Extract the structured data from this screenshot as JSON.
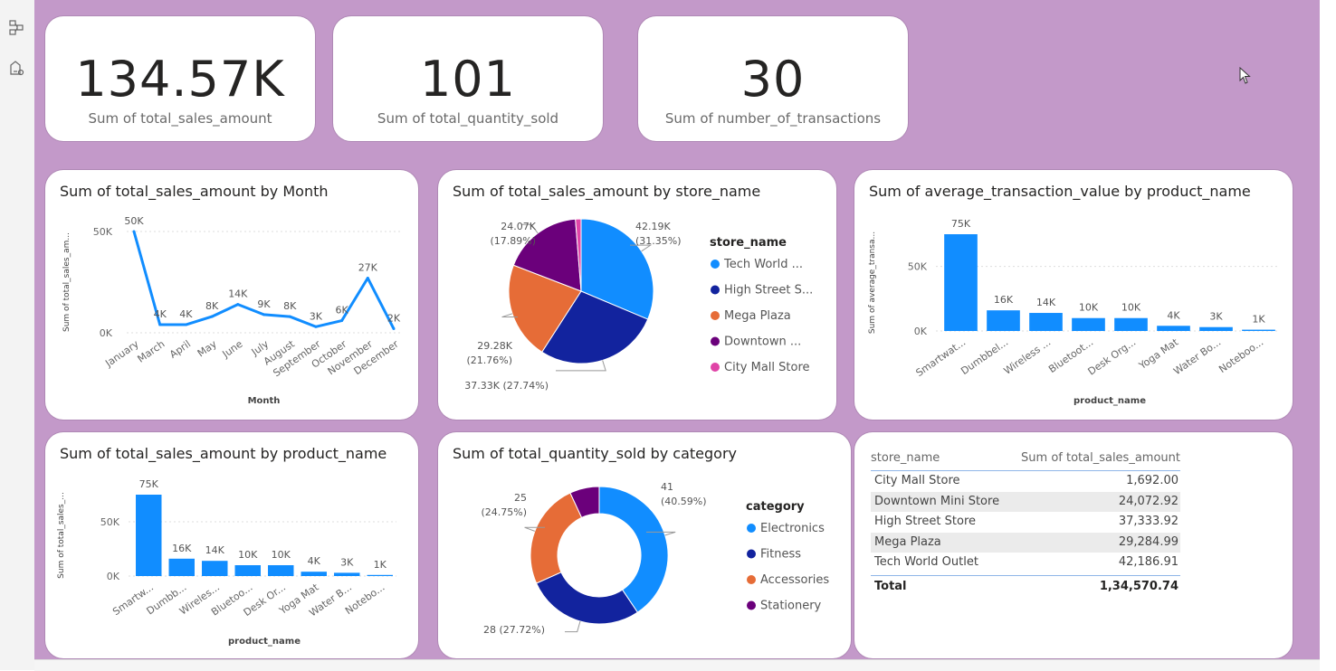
{
  "kpis": [
    {
      "value": "134.57K",
      "label": "Sum of total_sales_amount"
    },
    {
      "value": "101",
      "label": "Sum of total_quantity_sold"
    },
    {
      "value": "30",
      "label": "Sum of number_of_transactions"
    }
  ],
  "colors": {
    "canvas": "#c399c9",
    "blue": "#118dff",
    "navy": "#12239e",
    "orange": "#e66c37",
    "purple": "#6b007b",
    "magenta": "#e044a7"
  },
  "left_rail": {
    "icons": [
      "table-model-icon",
      "report-view-icon"
    ]
  },
  "chart_data": [
    {
      "type": "line",
      "title": "Sum of total_sales_amount by Month",
      "x": [
        "January",
        "March",
        "April",
        "May",
        "June",
        "July",
        "August",
        "September",
        "October",
        "November",
        "December"
      ],
      "values": [
        50,
        4,
        4,
        8,
        14,
        9,
        8,
        3,
        6,
        27,
        2
      ],
      "data_labels": [
        "50K",
        "4K",
        "4K",
        "8K",
        "14K",
        "9K",
        "8K",
        "3K",
        "6K",
        "27K",
        "2K"
      ],
      "yticks": [
        "0K",
        "50K"
      ],
      "ylim": [
        0,
        50
      ],
      "xlabel": "Month",
      "ylabel": "Sum of total_sales_am...",
      "grid": true
    },
    {
      "type": "pie",
      "title": "Sum of total_sales_amount by store_name",
      "legend_title": "store_name",
      "legend_position": "right",
      "slices": [
        {
          "name": "Tech World ...",
          "value": 42.19,
          "label": "42.19K",
          "pct": "(31.35%)",
          "color": "#118dff"
        },
        {
          "name": "High Street S...",
          "value": 37.33,
          "label": "37.33K (27.74%)",
          "pct": "",
          "color": "#12239e"
        },
        {
          "name": "Mega Plaza",
          "value": 29.28,
          "label": "29.28K",
          "pct": "(21.76%)",
          "color": "#e66c37"
        },
        {
          "name": "Downtown ...",
          "value": 24.07,
          "label": "24.07K",
          "pct": "(17.89%)",
          "color": "#6b007b"
        },
        {
          "name": "City Mall Store",
          "value": 1.69,
          "label": "",
          "pct": "",
          "color": "#e044a7"
        }
      ]
    },
    {
      "type": "bar",
      "title": "Sum of average_transaction_value by product_name",
      "categories": [
        "Smartwat...",
        "Dumbbel...",
        "Wireless ...",
        "Bluetoot...",
        "Desk Org...",
        "Yoga Mat",
        "Water Bo...",
        "Noteboo..."
      ],
      "values": [
        75,
        16,
        14,
        10,
        10,
        4,
        3,
        1
      ],
      "data_labels": [
        "75K",
        "16K",
        "14K",
        "10K",
        "10K",
        "4K",
        "3K",
        "1K"
      ],
      "yticks": [
        "0K",
        "50K"
      ],
      "ylim": [
        0,
        75
      ],
      "xlabel": "product_name",
      "ylabel": "Sum of average_transa...",
      "grid": true
    },
    {
      "type": "bar",
      "title": "Sum of total_sales_amount by product_name",
      "categories": [
        "Smartw...",
        "Dumbb...",
        "Wireles...",
        "Bluetoo...",
        "Desk Or...",
        "Yoga Mat",
        "Water B...",
        "Notebo..."
      ],
      "values": [
        75,
        16,
        14,
        10,
        10,
        4,
        3,
        1
      ],
      "data_labels": [
        "75K",
        "16K",
        "14K",
        "10K",
        "10K",
        "4K",
        "3K",
        "1K"
      ],
      "yticks": [
        "0K",
        "50K"
      ],
      "ylim": [
        0,
        75
      ],
      "xlabel": "product_name",
      "ylabel": "Sum of total_sales_...",
      "grid": true
    },
    {
      "type": "pie",
      "donut": true,
      "title": "Sum of total_quantity_sold by category",
      "legend_title": "category",
      "legend_position": "right",
      "slices": [
        {
          "name": "Electronics",
          "value": 41,
          "label": "41",
          "pct": "(40.59%)",
          "color": "#118dff"
        },
        {
          "name": "Fitness",
          "value": 28,
          "label": "28 (27.72%)",
          "pct": "",
          "color": "#12239e"
        },
        {
          "name": "Accessories",
          "value": 25,
          "label": "25",
          "pct": "(24.75%)",
          "color": "#e66c37"
        },
        {
          "name": "Stationery",
          "value": 7,
          "label": "",
          "pct": "",
          "color": "#6b007b"
        }
      ]
    },
    {
      "type": "table",
      "columns": [
        "store_name",
        "Sum of total_sales_amount"
      ],
      "rows": [
        [
          "City Mall Store",
          "1,692.00"
        ],
        [
          "Downtown Mini Store",
          "24,072.92"
        ],
        [
          "High Street Store",
          "37,333.92"
        ],
        [
          "Mega Plaza",
          "29,284.99"
        ],
        [
          "Tech World Outlet",
          "42,186.91"
        ]
      ],
      "total": [
        "Total",
        "1,34,570.74"
      ]
    }
  ]
}
